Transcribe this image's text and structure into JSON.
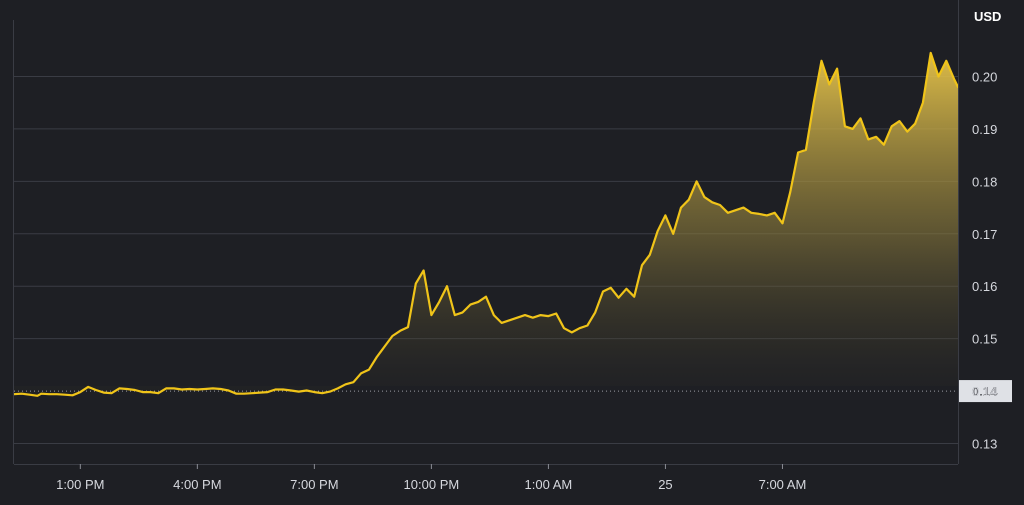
{
  "chart_data": {
    "type": "area",
    "title": "",
    "xlabel": "",
    "ylabel": "USD",
    "ylim": [
      0.12,
      0.205
    ],
    "grid": true,
    "y_ticks": [
      0.13,
      0.14,
      0.15,
      0.16,
      0.17,
      0.18,
      0.19,
      0.2
    ],
    "y_tick_labels": [
      "0.13",
      "0.14",
      "0.15",
      "0.16",
      "0.17",
      "0.18",
      "0.19",
      "0.20"
    ],
    "x_ticks": [
      {
        "t": 1,
        "label": "1:00 PM"
      },
      {
        "t": 4,
        "label": "4:00 PM"
      },
      {
        "t": 7,
        "label": "7:00 PM"
      },
      {
        "t": 10,
        "label": "10:00 PM"
      },
      {
        "t": 13,
        "label": "1:00 AM"
      },
      {
        "t": 16,
        "label": "25"
      },
      {
        "t": 19,
        "label": "7:00 AM"
      }
    ],
    "reference_line": {
      "value": 0.14,
      "label": "0.14"
    },
    "colors": {
      "background": "#1e1f24",
      "line": "#f0c419",
      "fill": "#e8c54a",
      "grid": "#3a3c44",
      "marker_bg": "#dfe1e6"
    },
    "series": [
      {
        "x": [
          -0.7,
          -0.5,
          -0.3,
          -0.1,
          0,
          0.2,
          0.4,
          0.6,
          0.8,
          1.0,
          1.2,
          1.4,
          1.6,
          1.8,
          2.0,
          2.2,
          2.4,
          2.6,
          2.8,
          3.0,
          3.2,
          3.4,
          3.6,
          3.8,
          4.0,
          4.2,
          4.4,
          4.6,
          4.8,
          5.0,
          5.2,
          5.4,
          5.6,
          5.8,
          6.0,
          6.2,
          6.4,
          6.6,
          6.8,
          7.0,
          7.2,
          7.4,
          7.6,
          7.8,
          8.0,
          8.2,
          8.4,
          8.6,
          8.8,
          9.0,
          9.2,
          9.4,
          9.6,
          9.8,
          10.0,
          10.2,
          10.4,
          10.6,
          10.8,
          11.0,
          11.2,
          11.4,
          11.6,
          11.8,
          12.0,
          12.2,
          12.4,
          12.6,
          12.8,
          13.0,
          13.2,
          13.4,
          13.6,
          13.8,
          14.0,
          14.2,
          14.4,
          14.6,
          14.8,
          15.0,
          15.2,
          15.4,
          15.6,
          15.8,
          16.0,
          16.2,
          16.4,
          16.6,
          16.8,
          17.0,
          17.2,
          17.4,
          17.6,
          17.8,
          18.0,
          18.2,
          18.4,
          18.6,
          18.8,
          19.0,
          19.2,
          19.4,
          19.6,
          19.8,
          20.0,
          20.2,
          20.4,
          20.6,
          20.8,
          21.0,
          21.2,
          21.4,
          21.6,
          21.8,
          22.0,
          22.2,
          22.4,
          22.6,
          22.8,
          23.0,
          23.2,
          23.4,
          23.5
        ],
        "values": [
          0.1394,
          0.1395,
          0.1393,
          0.1391,
          0.1395,
          0.1394,
          0.1394,
          0.1393,
          0.1392,
          0.1398,
          0.1408,
          0.1402,
          0.1397,
          0.1396,
          0.1405,
          0.1404,
          0.1402,
          0.1398,
          0.1398,
          0.1396,
          0.1405,
          0.1405,
          0.1403,
          0.1404,
          0.1403,
          0.1404,
          0.1405,
          0.1404,
          0.1401,
          0.1395,
          0.1395,
          0.1396,
          0.1397,
          0.1398,
          0.1403,
          0.1403,
          0.1401,
          0.1399,
          0.1401,
          0.1398,
          0.1396,
          0.1399,
          0.1405,
          0.1413,
          0.1417,
          0.1434,
          0.1441,
          0.1465,
          0.1485,
          0.1505,
          0.1515,
          0.1522,
          0.1605,
          0.163,
          0.1545,
          0.157,
          0.16,
          0.1545,
          0.155,
          0.1565,
          0.157,
          0.158,
          0.1545,
          0.153,
          0.1535,
          0.154,
          0.1545,
          0.154,
          0.1545,
          0.1543,
          0.1548,
          0.152,
          0.1512,
          0.152,
          0.1525,
          0.155,
          0.159,
          0.1597,
          0.1578,
          0.1595,
          0.158,
          0.164,
          0.166,
          0.1705,
          0.1735,
          0.17,
          0.175,
          0.1765,
          0.18,
          0.177,
          0.176,
          0.1755,
          0.174,
          0.1745,
          0.175,
          0.174,
          0.1738,
          0.1735,
          0.174,
          0.172,
          0.178,
          0.1855,
          0.186,
          0.195,
          0.203,
          0.1985,
          0.2015,
          0.1905,
          0.19,
          0.192,
          0.188,
          0.1885,
          0.187,
          0.1905,
          0.1915,
          0.1895,
          0.191,
          0.195,
          0.2045,
          0.2,
          0.203,
          0.1995,
          0.198
        ]
      }
    ]
  }
}
